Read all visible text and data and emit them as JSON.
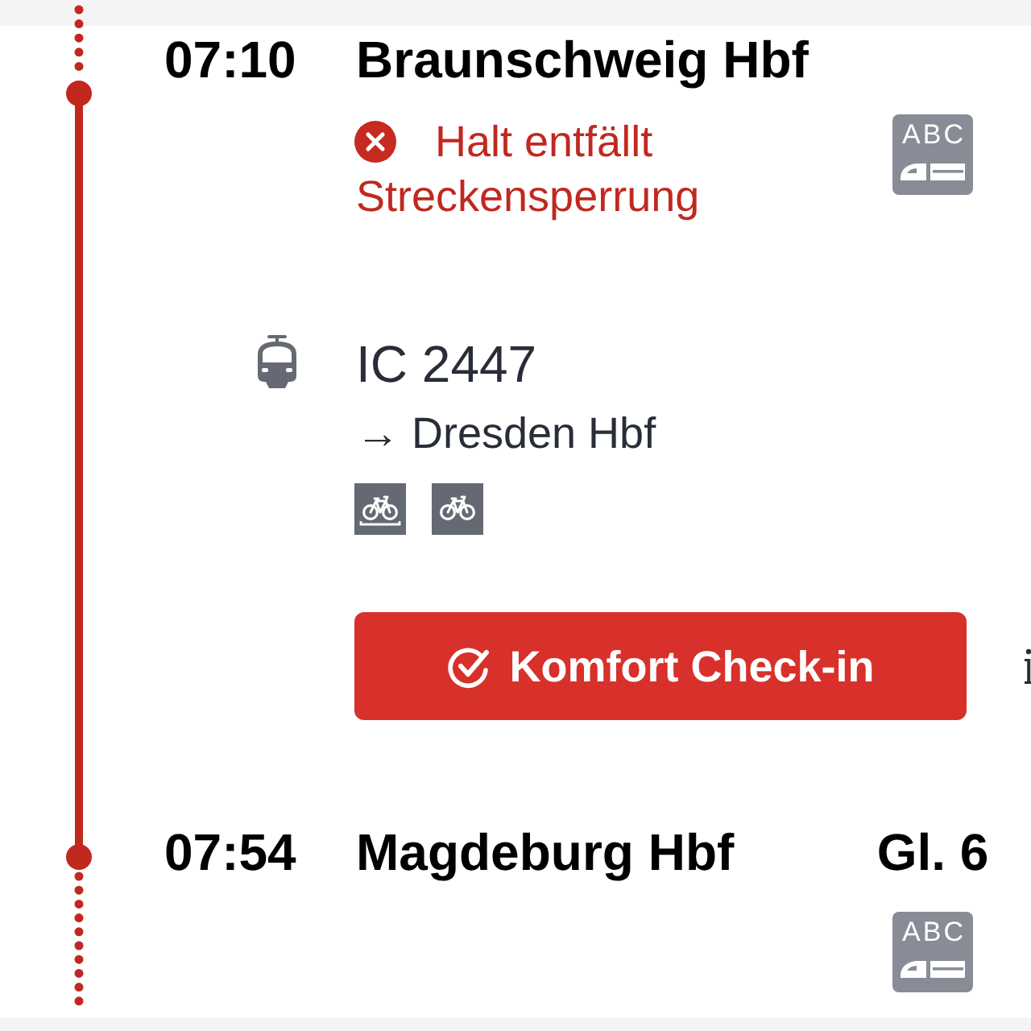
{
  "departure_stop": {
    "time": "07:10",
    "station": "Braunschweig Hbf",
    "cancelled": true,
    "status": "Halt entfällt",
    "reason": "Streckensperrung",
    "coach_sequence": "ABC"
  },
  "train": {
    "name": "IC 2447",
    "direction": "→ Dresden Hbf",
    "amenities": [
      {
        "kind": "bicycle_reservation"
      },
      {
        "kind": "bicycle"
      }
    ]
  },
  "checkin_button": {
    "label": "Komfort Check-in"
  },
  "arrival_stop": {
    "time": "07:54",
    "station": "Magdeburg Hbf",
    "platform": "Gl. 6",
    "coach_sequence": "ABC"
  }
}
